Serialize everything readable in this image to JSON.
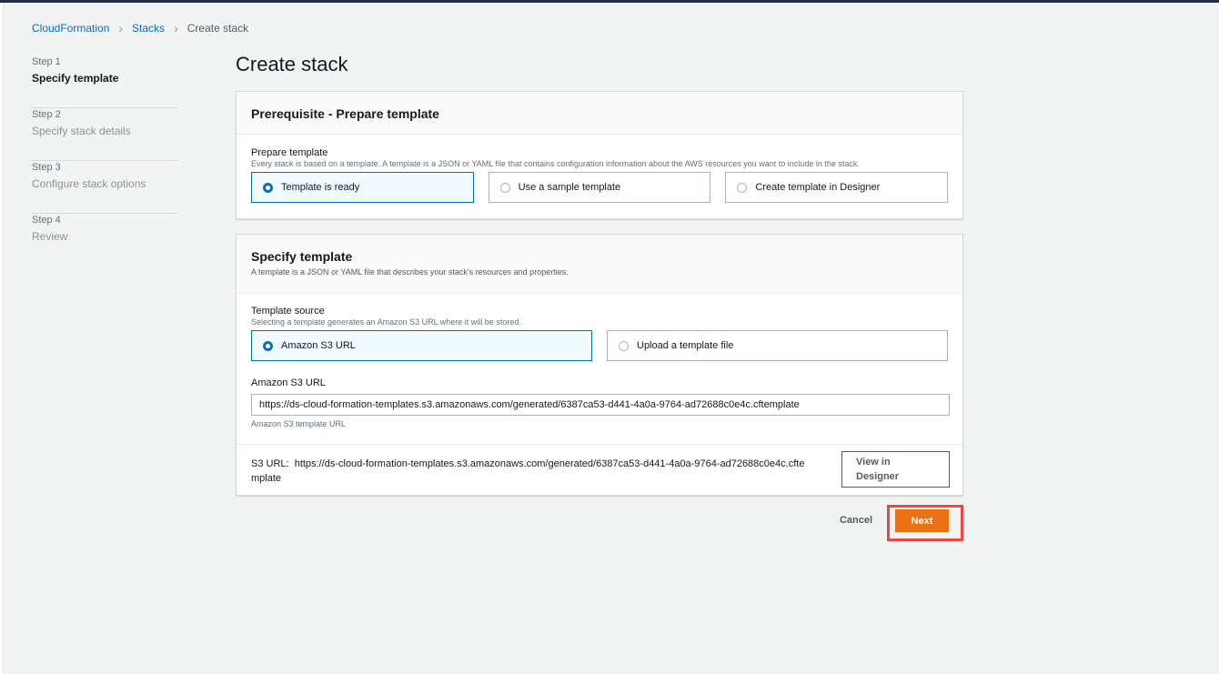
{
  "breadcrumb": {
    "item1": "CloudFormation",
    "item2": "Stacks",
    "current": "Create stack"
  },
  "steps": [
    {
      "num": "Step 1",
      "label": "Specify template"
    },
    {
      "num": "Step 2",
      "label": "Specify stack details"
    },
    {
      "num": "Step 3",
      "label": "Configure stack options"
    },
    {
      "num": "Step 4",
      "label": "Review"
    }
  ],
  "page_title": "Create stack",
  "prerequisite": {
    "title": "Prerequisite - Prepare template",
    "field_label": "Prepare template",
    "field_desc": "Every stack is based on a template. A template is a JSON or YAML file that contains configuration information about the AWS resources you want to include in the stack.",
    "options": [
      "Template is ready",
      "Use a sample template",
      "Create template in Designer"
    ],
    "selected": "Template is ready"
  },
  "specify": {
    "title": "Specify template",
    "desc": "A template is a JSON or YAML file that describes your stack's resources and properties.",
    "source_label": "Template source",
    "source_desc": "Selecting a template generates an Amazon S3 URL where it will be stored.",
    "source_options": [
      "Amazon S3 URL",
      "Upload a template file"
    ],
    "source_selected": "Amazon S3 URL",
    "url_label": "Amazon S3 URL",
    "url_value": "https://ds-cloud-formation-templates.s3.amazonaws.com/generated/6387ca53-d441-4a0a-9764-ad72688c0e4c.cftemplate",
    "url_hint": "Amazon S3 template URL",
    "s3_url_prefix": "S3 URL:",
    "s3_url_line1": "https://ds-cloud-formation-templates.s3.amazonaws.com/generated/6387ca53-d441-4a0a-9764-ad72688c0e4c.cfte",
    "s3_url_line2": "mplate",
    "view_designer": "View in Designer"
  },
  "actions": {
    "cancel": "Cancel",
    "next": "Next"
  },
  "colors": {
    "accent": "#0073bb",
    "primary_button": "#ec7211",
    "highlight_box": "#ed4747"
  }
}
